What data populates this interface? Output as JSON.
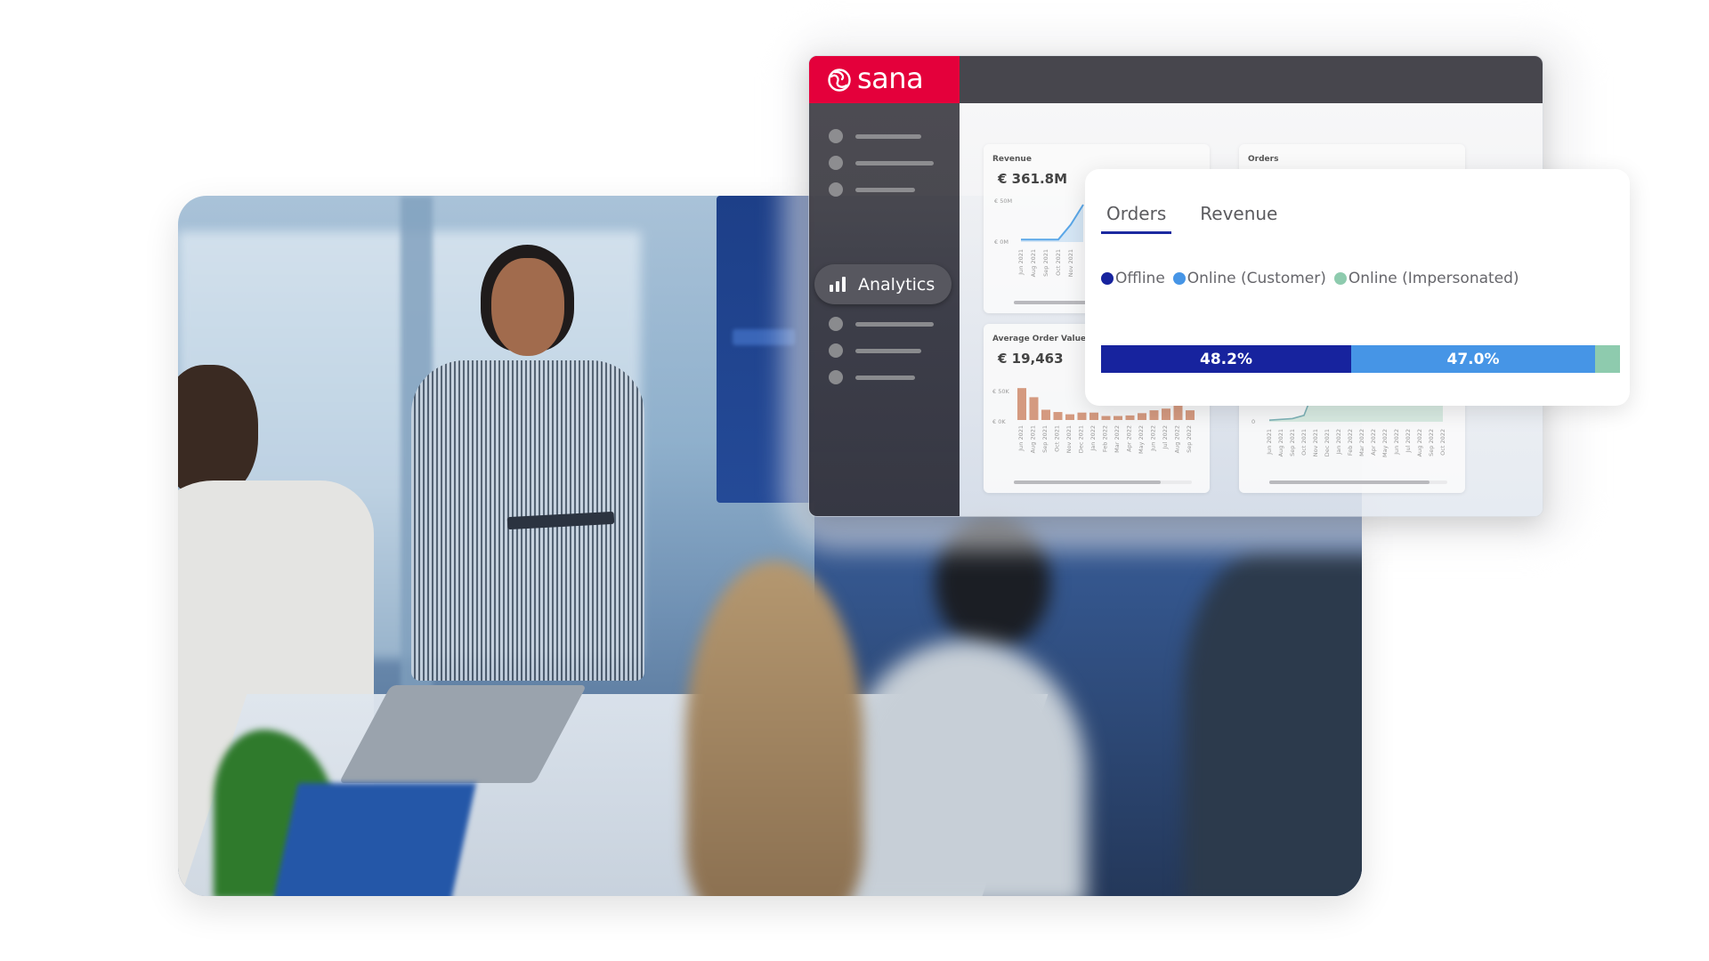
{
  "brand": {
    "name": "sana",
    "color": "#e4003b"
  },
  "sidebar": {
    "items": [
      {
        "type": "placeholder"
      },
      {
        "type": "placeholder"
      },
      {
        "type": "placeholder"
      },
      {
        "type": "active",
        "label": "Analytics",
        "icon": "bar-chart-icon"
      },
      {
        "type": "placeholder"
      },
      {
        "type": "placeholder"
      },
      {
        "type": "placeholder"
      }
    ],
    "active_label": "Analytics"
  },
  "cards": {
    "revenue": {
      "title": "Revenue",
      "value": "€ 361.8M",
      "y_ticks": [
        "€ 50M",
        "€ 0M"
      ],
      "x_labels": [
        "Jun 2021",
        "Aug 2021",
        "Sep 2021",
        "Oct 2021",
        "Nov 2021"
      ],
      "series": [
        2,
        2,
        2,
        2,
        14,
        30
      ]
    },
    "orders": {
      "title": "Orders",
      "y_ticks": [
        "0"
      ],
      "x_labels": [
        "Jun 2021",
        "Aug 2021",
        "Sep 2021",
        "Oct 2021",
        "Nov 2021",
        "Dec 2021",
        "Jan 2022",
        "Feb 2022",
        "Mar 2022",
        "Apr 2022",
        "May 2022",
        "Jun 2022",
        "Jul 2022",
        "Aug 2022",
        "Sep 2022",
        "Oct 2022"
      ],
      "series": [
        2,
        3,
        4,
        8,
        45,
        80,
        92,
        88,
        84,
        80,
        84,
        84,
        88,
        92,
        82,
        96
      ]
    },
    "aov": {
      "title": "Average Order Value",
      "value": "€ 19,463",
      "y_ticks": [
        "€ 50K",
        "€ 0K"
      ],
      "x_labels": [
        "Jun 2021",
        "Aug 2021",
        "Sep 2021",
        "Oct 2021",
        "Nov 2021",
        "Dec 2021",
        "Jan 2022",
        "Feb 2022",
        "Mar 2022",
        "Apr 2022",
        "May 2022",
        "Jun 2022",
        "Jul 2022",
        "Aug 2022",
        "Sep 2022"
      ],
      "values_k": [
        56,
        40,
        18,
        14,
        10,
        13,
        13,
        7,
        7,
        8,
        12,
        17,
        20,
        26,
        17
      ]
    }
  },
  "popup": {
    "tabs": [
      {
        "label": "Orders",
        "active": true
      },
      {
        "label": "Revenue",
        "active": false
      }
    ],
    "legend": [
      {
        "label": "Offline",
        "color": "#17239e"
      },
      {
        "label": "Online (Customer)",
        "color": "#4695e6"
      },
      {
        "label": "Online (Impersonated)",
        "color": "#8ecbae"
      }
    ],
    "segments": [
      {
        "name": "Offline",
        "percent": 48.2,
        "label": "48.2%",
        "color": "#17239e"
      },
      {
        "name": "Online (Customer)",
        "percent": 47.0,
        "label": "47.0%",
        "color": "#4695e6"
      },
      {
        "name": "Online (Impersonated)",
        "percent": 4.8,
        "label": "",
        "color": "#8ecbae"
      }
    ]
  },
  "photo": {
    "description": "Meeting room: presenter with tablet addressing seated colleagues"
  }
}
